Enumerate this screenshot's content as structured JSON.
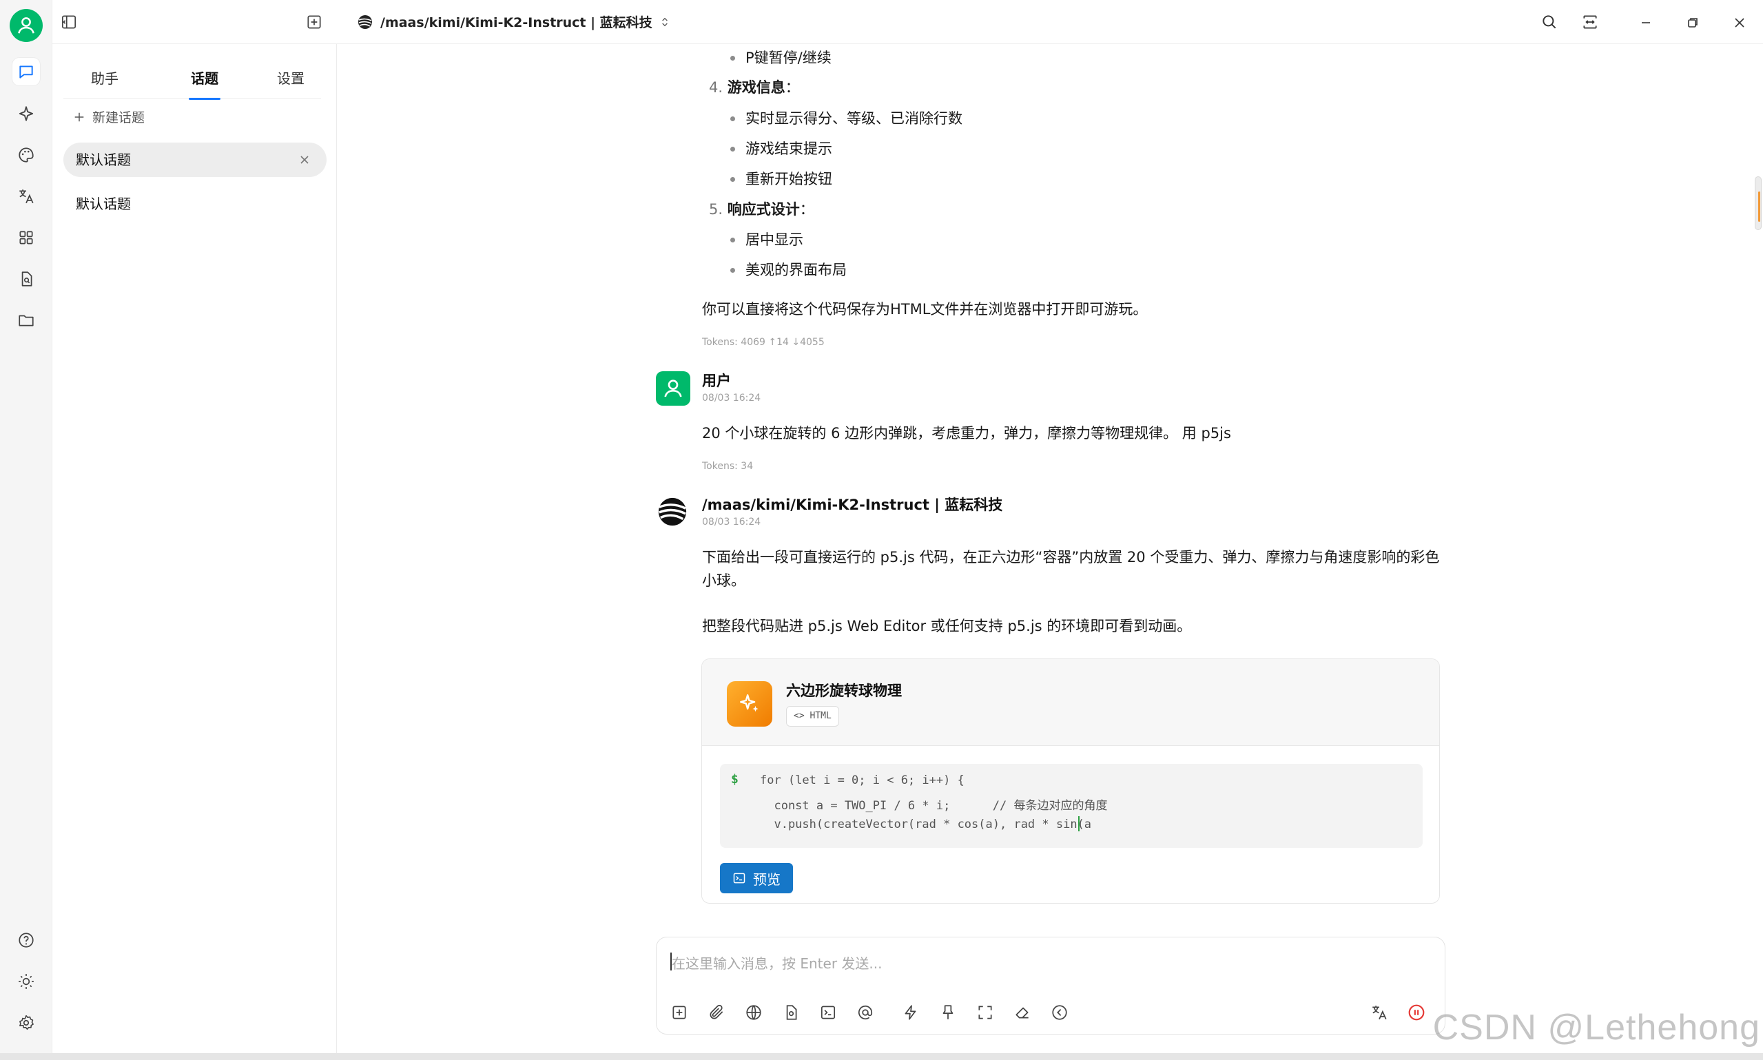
{
  "topbar": {
    "model_title": "/maas/kimi/Kimi-K2-Instruct | 蓝耘科技"
  },
  "panel": {
    "tabs": [
      "助手",
      "话题",
      "设置"
    ],
    "active_tab": "话题",
    "new_topic": "新建话题",
    "topics": [
      {
        "label": "默认话题",
        "active": true
      },
      {
        "label": "默认话题",
        "active": false
      }
    ]
  },
  "prev_reply": {
    "item_p": "P键暂停/继续",
    "sec4_num": "4.",
    "sec4_title": "游戏信息",
    "sec4_items": [
      "实时显示得分、等级、已消除行数",
      "游戏结束提示",
      "重新开始按钮"
    ],
    "sec5_num": "5.",
    "sec5_title": "响应式设计",
    "sec5_items": [
      "居中显示",
      "美观的界面布局"
    ],
    "closing": "你可以直接将这个代码保存为HTML文件并在浏览器中打开即可游玩。",
    "tokens": "Tokens: 4069 ↑14 ↓4055"
  },
  "user_msg": {
    "name": "用户",
    "time": "08/03 16:24",
    "text": "20 个小球在旋转的 6 边形内弹跳，考虑重力，弹力，摩擦力等物理规律。 用 p5js",
    "tokens": "Tokens: 34"
  },
  "model_msg": {
    "name": "/maas/kimi/Kimi-K2-Instruct | 蓝耘科技",
    "time": "08/03 16:24",
    "para1": "下面给出一段可直接运行的 p5.js 代码，在正六边形“容器”内放置 20 个受重力、弹力、摩擦力与角速度影响的彩色小球。",
    "para2": "把整段代码贴进 p5.js Web Editor 或任何支持 p5.js 的环境即可看到动画。"
  },
  "artifact": {
    "title": "六边形旋转球物理",
    "badge": "<> HTML",
    "prompt": "$",
    "code_lines": [
      "for (let i = 0; i < 6; i++) {",
      "  const a = TWO_PI / 6 * i;      // 每条边对应的角度",
      "  v.push(createVector(rad * cos(a), rad * sin(a"
    ],
    "preview": "预览"
  },
  "input": {
    "placeholder": "在这里输入消息，按 Enter 发送..."
  },
  "watermark": "CSDN @Lethehong",
  "colors": {
    "accent": "#1677ff",
    "brand_green": "#00b96b",
    "preview_btn": "#1677c8",
    "artifact_icon": "#f59a1b",
    "stop_red": "#e53935"
  }
}
